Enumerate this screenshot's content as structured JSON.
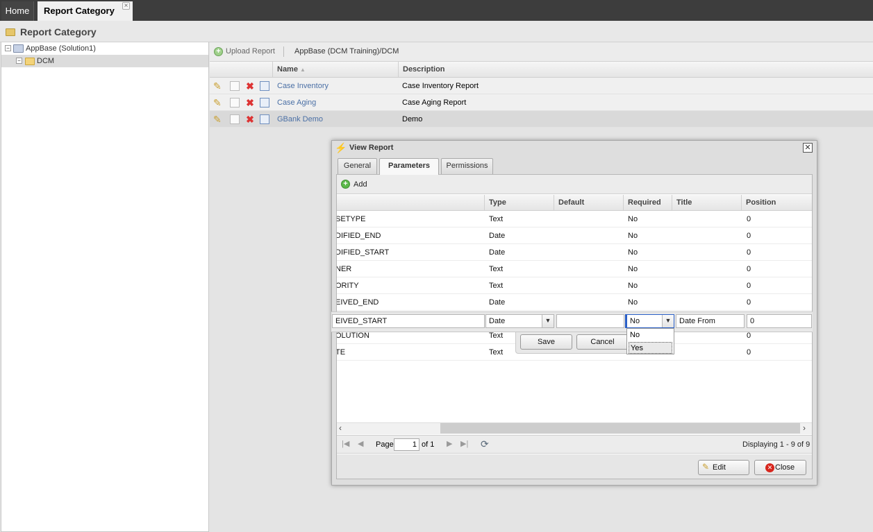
{
  "tabs": {
    "home": "Home",
    "active": "Report Category",
    "close_glyph": "×"
  },
  "page": {
    "title": "Report Category"
  },
  "tree": {
    "root": {
      "label": "AppBase (Solution1)",
      "expander": "−"
    },
    "child": {
      "label": "DCM",
      "expander": "−"
    }
  },
  "toolbar": {
    "upload": "Upload Report",
    "path": "AppBase (DCM Training)/DCM"
  },
  "grid": {
    "columns": [
      "Name",
      "Description"
    ],
    "rows": [
      {
        "name": "Case Inventory",
        "description": "Case Inventory Report"
      },
      {
        "name": "Case Aging",
        "description": "Case Aging Report"
      },
      {
        "name": "GBank Demo",
        "description": "Demo"
      }
    ]
  },
  "dialog": {
    "title": "View Report",
    "tabs": [
      "General",
      "Parameters",
      "Permissions"
    ],
    "add": "Add",
    "columns": [
      "Type",
      "Default",
      "Required",
      "Title",
      "Position"
    ],
    "rows": [
      {
        "name": "SETYPE",
        "type": "Text",
        "default": "",
        "required": "No",
        "title": "",
        "position": "0"
      },
      {
        "name": "DIFIED_END",
        "type": "Date",
        "default": "",
        "required": "No",
        "title": "",
        "position": "0"
      },
      {
        "name": "DIFIED_START",
        "type": "Date",
        "default": "",
        "required": "No",
        "title": "",
        "position": "0"
      },
      {
        "name": "NER",
        "type": "Text",
        "default": "",
        "required": "No",
        "title": "",
        "position": "0"
      },
      {
        "name": "ORITY",
        "type": "Text",
        "default": "",
        "required": "No",
        "title": "",
        "position": "0"
      },
      {
        "name": "EIVED_END",
        "type": "Date",
        "default": "",
        "required": "No",
        "title": "",
        "position": "0"
      },
      {
        "name": "OLUTION",
        "type": "Text",
        "default": "",
        "required": "",
        "title": "",
        "position": "0"
      },
      {
        "name": "TE",
        "type": "Text",
        "default": "",
        "required": "",
        "title": "",
        "position": "0"
      }
    ],
    "editor": {
      "name": "EIVED_START",
      "type": "Date",
      "default": "",
      "required": "No",
      "title": "Date From",
      "position": "0"
    },
    "editor_buttons": {
      "save": "Save",
      "cancel": "Cancel"
    },
    "dropdown_options": [
      "No",
      "Yes"
    ],
    "paging": {
      "page_label": "Page",
      "page": "1",
      "of": "of 1",
      "display": "Displaying 1 - 9 of 9"
    },
    "footer": {
      "edit": "Edit",
      "close": "Close"
    }
  },
  "colors": {
    "topbar": "#3d3d3d",
    "link": "#4a6fa5",
    "delete": "#dd3333",
    "focus": "#2a5fc7"
  }
}
